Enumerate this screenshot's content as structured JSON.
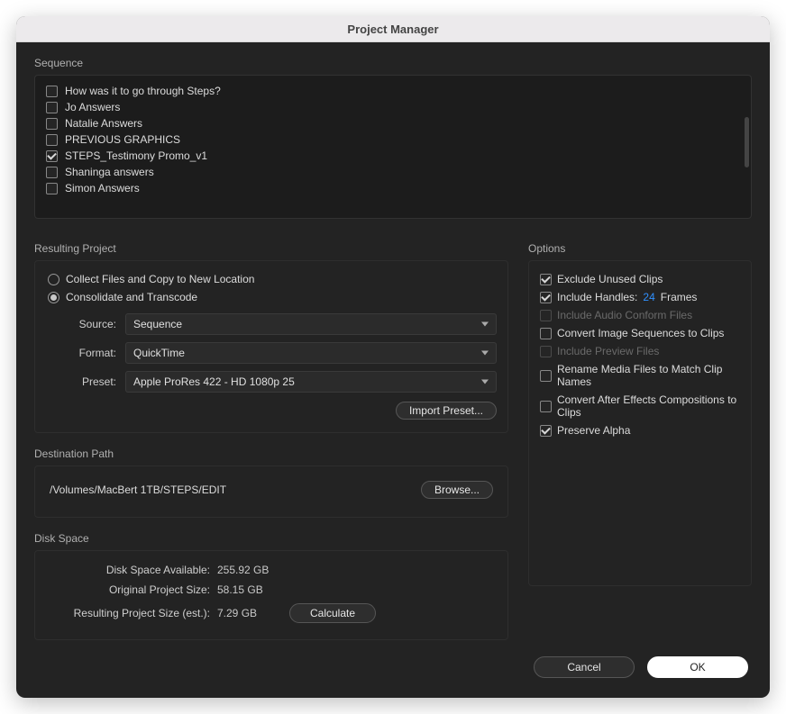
{
  "title": "Project Manager",
  "sequence": {
    "label": "Sequence",
    "items": [
      {
        "label": "How was it to go through Steps?",
        "checked": false
      },
      {
        "label": "Jo Answers",
        "checked": false
      },
      {
        "label": "Natalie Answers",
        "checked": false
      },
      {
        "label": "PREVIOUS GRAPHICS",
        "checked": false
      },
      {
        "label": "STEPS_Testimony Promo_v1",
        "checked": true
      },
      {
        "label": "Shaninga answers",
        "checked": false
      },
      {
        "label": "Simon Answers",
        "checked": false
      }
    ]
  },
  "resulting": {
    "label": "Resulting Project",
    "radio_collect": "Collect Files and Copy to New Location",
    "radio_consolidate": "Consolidate and Transcode",
    "selected": "consolidate",
    "source_label": "Source:",
    "source_value": "Sequence",
    "format_label": "Format:",
    "format_value": "QuickTime",
    "preset_label": "Preset:",
    "preset_value": "Apple ProRes 422 - HD 1080p 25",
    "import_preset": "Import Preset..."
  },
  "options": {
    "label": "Options",
    "items": [
      {
        "key": "exclude",
        "label": "Exclude Unused Clips",
        "checked": true,
        "disabled": false
      },
      {
        "key": "handles",
        "label": "Include Handles:",
        "checked": true,
        "disabled": false,
        "handles_value": "24",
        "handles_suffix": "Frames"
      },
      {
        "key": "audio",
        "label": "Include Audio Conform Files",
        "checked": false,
        "disabled": true
      },
      {
        "key": "convert_img",
        "label": "Convert Image Sequences to Clips",
        "checked": false,
        "disabled": false
      },
      {
        "key": "preview",
        "label": "Include Preview Files",
        "checked": false,
        "disabled": true
      },
      {
        "key": "rename",
        "label": "Rename Media Files to Match Clip Names",
        "checked": false,
        "disabled": false
      },
      {
        "key": "ae",
        "label": "Convert After Effects Compositions to Clips",
        "checked": false,
        "disabled": false
      },
      {
        "key": "alpha",
        "label": "Preserve Alpha",
        "checked": true,
        "disabled": false
      }
    ]
  },
  "destination": {
    "label": "Destination Path",
    "path": "/Volumes/MacBert 1TB/STEPS/EDIT",
    "browse": "Browse..."
  },
  "disk": {
    "label": "Disk Space",
    "avail_label": "Disk Space Available:",
    "avail_value": "255.92 GB",
    "orig_label": "Original Project Size:",
    "orig_value": "58.15 GB",
    "est_label": "Resulting Project Size (est.):",
    "est_value": "7.29 GB",
    "calculate": "Calculate"
  },
  "footer": {
    "cancel": "Cancel",
    "ok": "OK"
  }
}
